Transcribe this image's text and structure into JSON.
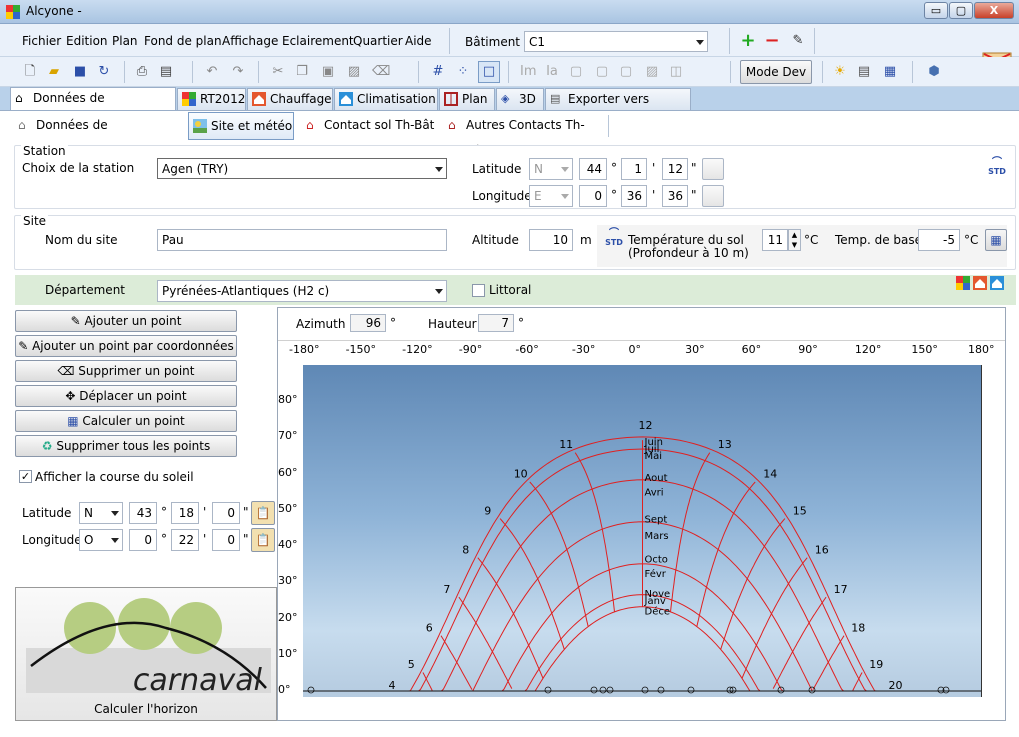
{
  "window": {
    "title": "Alcyone -",
    "min_label": "▭",
    "max_label": "▢",
    "close_label": "X"
  },
  "menu": {
    "items": [
      "Fichier",
      "Edition",
      "Plan",
      "Fond de plan",
      "Affichage",
      "Eclairement",
      "Quartier",
      "Aide"
    ],
    "batiment_label": "Bâtiment",
    "batiment_value": "C1"
  },
  "toolbar": {
    "mode_dev_label": "Mode Dev"
  },
  "tabs": [
    {
      "label": "Données de construction"
    },
    {
      "label": "RT2012"
    },
    {
      "label": "Chauffage"
    },
    {
      "label": "Climatisation"
    },
    {
      "label": "Plan"
    },
    {
      "label": "3D"
    },
    {
      "label": "Exporter vers Pleiades"
    }
  ],
  "subtabs": [
    {
      "label": "Données de construction"
    },
    {
      "label": "Site et météo"
    },
    {
      "label": "Contact sol Th-Bât"
    },
    {
      "label": "Autres Contacts Th-Bât"
    }
  ],
  "station": {
    "group_title": "Station",
    "choice_label": "Choix de la station",
    "choice_value": "Agen (TRY)",
    "latitude_label": "Latitude",
    "lat_hemi": "N",
    "lat_deg": "44",
    "lat_min": "1",
    "lat_sec": "12",
    "longitude_label": "Longitude",
    "lon_hemi": "E",
    "lon_deg": "0",
    "lon_min": "36",
    "lon_sec": "36",
    "deg_sym": "°",
    "min_sym": "'",
    "sec_sym": "\"",
    "std_label": "STD"
  },
  "site": {
    "group_title": "Site",
    "name_label": "Nom du site",
    "name_value": "Pau",
    "altitude_label": "Altitude",
    "altitude_value": "10",
    "altitude_unit": "m",
    "std_label": "STD",
    "soil_temp_label": "Température du sol",
    "soil_temp_sub": "(Profondeur à 10 m)",
    "soil_temp_value": "11",
    "temp_unit": "°C",
    "base_temp_label": "Temp. de base",
    "base_temp_value": "-5",
    "departement_label": "Département",
    "departement_value": "Pyrénées-Atlantiques (H2 c)",
    "littoral_label": "Littoral",
    "littoral_checked": false
  },
  "left_panel": {
    "buttons": [
      "Ajouter un point",
      "Ajouter un point par coordonnées",
      "Supprimer un point",
      "Déplacer un point",
      "Calculer un point",
      "Supprimer tous les points"
    ],
    "show_sun_label": "Afficher la course du soleil",
    "show_sun_checked": true,
    "latitude_label": "Latitude",
    "lat_hemi": "N",
    "lat_deg": "43",
    "lat_min": "18",
    "lat_sec": "0",
    "longitude_label": "Longitude",
    "lon_hemi": "O",
    "lon_deg": "0",
    "lon_min": "22",
    "lon_sec": "0",
    "logo_text": "carnaval",
    "calc_horizon_label": "Calculer l'horizon"
  },
  "diagram": {
    "azimuth_label": "Azimuth",
    "azimuth_value": "96",
    "hauteur_label": "Hauteur",
    "hauteur_value": "7",
    "deg_sym": "°",
    "x_ticks": [
      "-180°",
      "-150°",
      "-120°",
      "-90°",
      "-60°",
      "-30°",
      "0°",
      "30°",
      "60°",
      "90°",
      "120°",
      "150°",
      "180°"
    ],
    "y_ticks": [
      "80°",
      "70°",
      "60°",
      "50°",
      "40°",
      "30°",
      "20°",
      "10°",
      "0°"
    ],
    "hours": [
      "4",
      "5",
      "6",
      "7",
      "8",
      "9",
      "10",
      "11",
      "12",
      "13",
      "14",
      "15",
      "16",
      "17",
      "18",
      "19",
      "20"
    ],
    "months": [
      "Juin",
      "Juil",
      "Mai",
      "Aout",
      "Avri",
      "Sept",
      "Mars",
      "Octo",
      "Févr",
      "Nove",
      "Janv",
      "Déce"
    ],
    "curve_color": "#e02020"
  }
}
